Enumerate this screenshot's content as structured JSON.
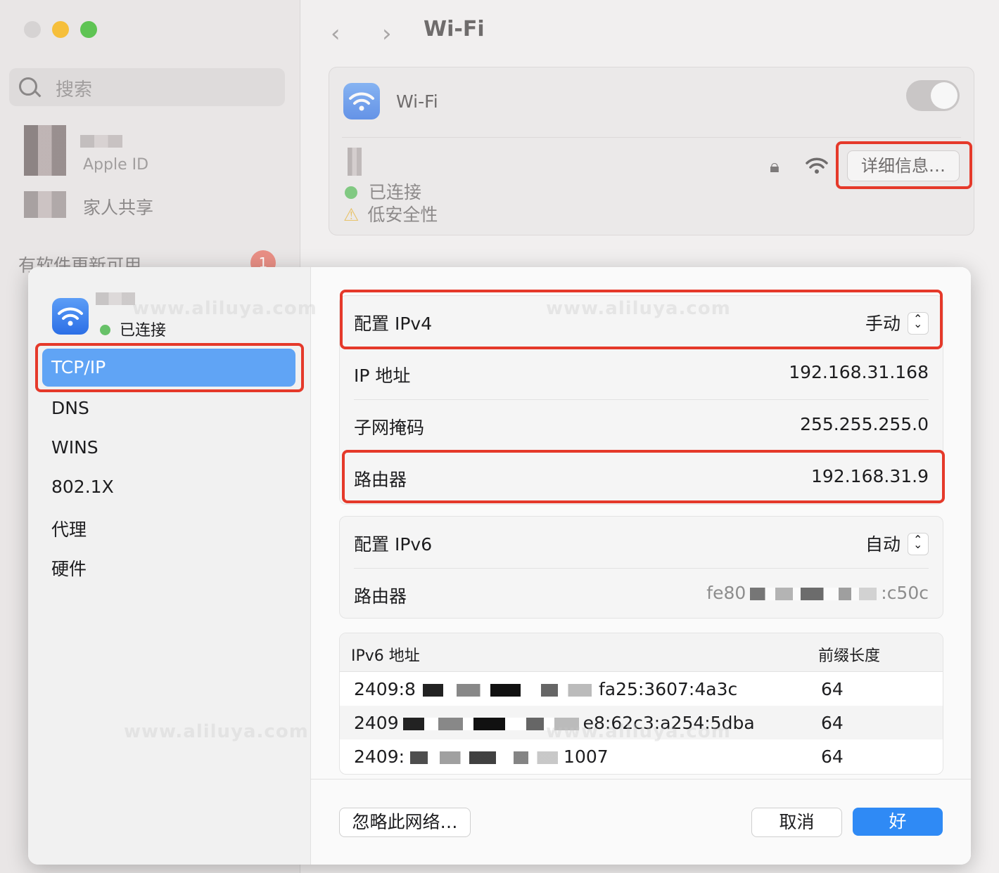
{
  "background": {
    "search_placeholder": "搜索",
    "apple_id_label": "Apple ID",
    "family_label": "家人共享",
    "update_label": "有软件更新可用",
    "update_badge": "1",
    "title": "Wi-Fi",
    "wifi_label": "Wi-Fi",
    "status_connected": "已连接",
    "status_security": "低安全性",
    "details_button": "详细信息…"
  },
  "sheet": {
    "network_status": "已连接",
    "sidebar": [
      {
        "label": "TCP/IP",
        "active": true
      },
      {
        "label": "DNS"
      },
      {
        "label": "WINS"
      },
      {
        "label": "802.1X"
      },
      {
        "label": "代理"
      },
      {
        "label": "硬件"
      }
    ],
    "ipv4": {
      "configure_label": "配置 IPv4",
      "configure_value": "手动",
      "ip_label": "IP 地址",
      "ip_value": "192.168.31.168",
      "subnet_label": "子网掩码",
      "subnet_value": "255.255.255.0",
      "router_label": "路由器",
      "router_value": "192.168.31.9"
    },
    "ipv6": {
      "configure_label": "配置 IPv6",
      "configure_value": "自动",
      "router_label": "路由器",
      "router_value_prefix": "fe80",
      "router_value_suffix": ":c50c"
    },
    "ipv6_table": {
      "headers": [
        "IPv6 地址",
        "前缀长度"
      ],
      "rows": [
        {
          "addr_prefix": "2409:8",
          "addr_suffix": "fa25:3607:4a3c",
          "prefix": "64"
        },
        {
          "addr_prefix": "2409",
          "addr_suffix": "e8:62c3:a254:5dba",
          "prefix": "64"
        },
        {
          "addr_prefix": "2409:",
          "addr_suffix": "1007",
          "prefix": "64"
        }
      ]
    },
    "buttons": {
      "forget": "忽略此网络…",
      "cancel": "取消",
      "ok": "好"
    }
  },
  "watermark": "www.aliluya.com",
  "colors": {
    "accent": "#2f8af5",
    "sidebar_active": "#60a4f5",
    "highlight": "#e5392a",
    "connected_dot": "#67c168"
  }
}
